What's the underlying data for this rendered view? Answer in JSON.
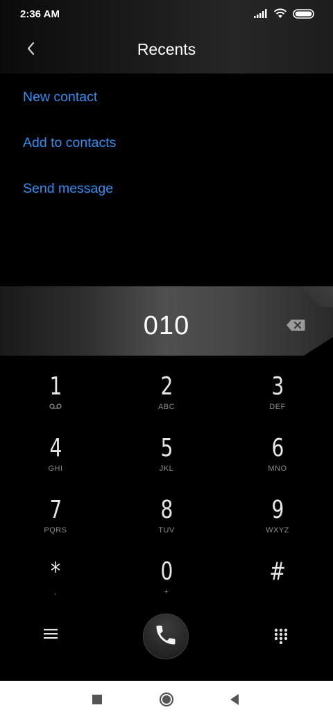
{
  "status_bar": {
    "time": "2:36 AM",
    "icons": [
      "signal-icon",
      "wifi-icon",
      "battery-icon"
    ]
  },
  "header": {
    "back_icon": "chevron-left-icon",
    "title": "Recents"
  },
  "options": {
    "new_contact": "New contact",
    "add_to_contacts": "Add to contacts",
    "send_message": "Send message"
  },
  "dial_display": {
    "number": "010",
    "backspace_icon": "backspace-icon"
  },
  "keypad": {
    "keys": [
      {
        "digit": "1",
        "letters": ""
      },
      {
        "digit": "2",
        "letters": "ABC"
      },
      {
        "digit": "3",
        "letters": "DEF"
      },
      {
        "digit": "4",
        "letters": "GHI"
      },
      {
        "digit": "5",
        "letters": "JKL"
      },
      {
        "digit": "6",
        "letters": "MNO"
      },
      {
        "digit": "7",
        "letters": "PQRS"
      },
      {
        "digit": "8",
        "letters": "TUV"
      },
      {
        "digit": "9",
        "letters": "WXYZ"
      },
      {
        "digit": "*",
        "letters": ","
      },
      {
        "digit": "0",
        "letters": "+"
      },
      {
        "digit": "#",
        "letters": ""
      }
    ]
  },
  "controls": {
    "menu_icon": "menu-icon",
    "call_icon": "phone-icon",
    "dialpad_icon": "dialpad-icon"
  },
  "nav_bar": {
    "icons": [
      "square-icon",
      "home-circle-icon",
      "back-triangle-icon"
    ]
  },
  "colors": {
    "accent": "#2f8ff2",
    "background": "#000000",
    "nav_background": "#ffffff"
  }
}
